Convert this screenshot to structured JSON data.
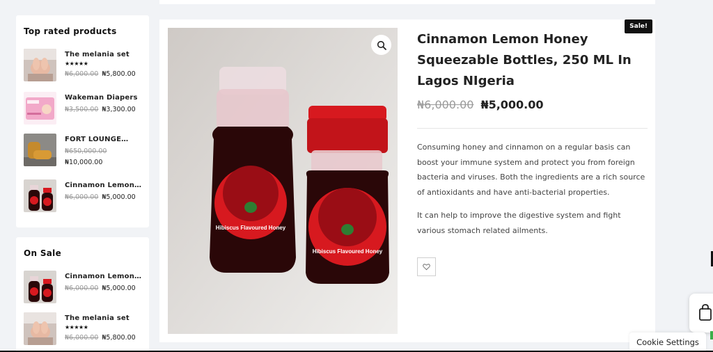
{
  "top_rated": {
    "title": "Top rated products",
    "items": [
      {
        "name": "The melania set",
        "stars": "★★★★★",
        "old_price": "₦6,000.00",
        "new_price": "₦5,800.00",
        "thumb": "hands-icon"
      },
      {
        "name": "Wakeman Diapers",
        "old_price": "₦3,500.00",
        "new_price": "₦3,300.00",
        "thumb": "diaper-pack-icon"
      },
      {
        "name": "FORT LOUNGE…",
        "old_price": "₦650,000.00",
        "new_price": "₦10,000.00",
        "thumb": "lounge-chair-icon"
      },
      {
        "name": "Cinnamon Lemon…",
        "old_price": "₦6,000.00",
        "new_price": "₦5,000.00",
        "thumb": "honey-bottles-icon"
      }
    ]
  },
  "on_sale": {
    "title": "On Sale",
    "items": [
      {
        "name": "Cinnamon Lemon…",
        "old_price": "₦6,000.00",
        "new_price": "₦5,000.00",
        "thumb": "honey-bottles-icon"
      },
      {
        "name": "The melania set",
        "stars": "★★★★★",
        "old_price": "₦6,000.00",
        "new_price": "₦5,800.00",
        "thumb": "hands-icon"
      }
    ]
  },
  "product": {
    "badge": "Sale!",
    "title": "Cinnamon Lemon Honey Squeezable Bottles, 250 ML In Lagos NIgeria",
    "old_price": "₦6,000.00",
    "new_price": "₦5,000.00",
    "description_1": "Consuming honey and cinnamon on a regular basis can boost your immune system and protect you from foreign bacteria and viruses. Both the ingredients are a rich source of antioxidants and have anti-bacterial properties.",
    "description_2": "It can help to improve the digestive system and fight various stomach related ailments.",
    "image_label": "Hibiscus Flavoured Honey"
  },
  "footer": {
    "cookie_settings": "Cookie Settings"
  },
  "colors": {
    "page_bg": "#f1f3f6",
    "honey_red": "#d7191f",
    "honey_dark": "#2a0708"
  }
}
